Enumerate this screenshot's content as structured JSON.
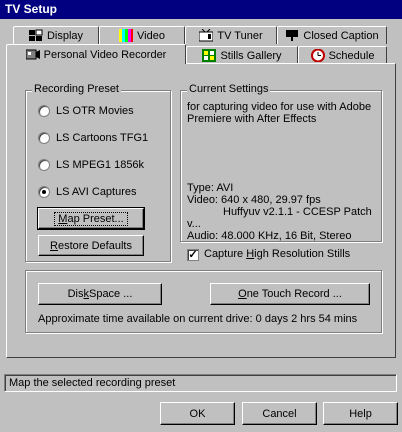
{
  "window": {
    "title": "TV Setup"
  },
  "tabs_row1": [
    {
      "label": "Display"
    },
    {
      "label": "Video"
    },
    {
      "label": "TV Tuner"
    },
    {
      "label": "Closed Caption"
    }
  ],
  "tabs_row2": [
    {
      "label": "Personal Video Recorder",
      "active": true
    },
    {
      "label": "Stills Gallery"
    },
    {
      "label": "Schedule"
    }
  ],
  "recording_preset": {
    "group_label": "Recording Preset",
    "options": [
      {
        "label": "LS OTR Movies",
        "checked": false
      },
      {
        "label": "LS Cartoons TFG1",
        "checked": false
      },
      {
        "label": "LS MPEG1 1856k",
        "checked": false
      },
      {
        "label": "LS AVI Captures",
        "checked": true
      }
    ],
    "map_button_prefix": "M",
    "map_button_rest": "ap Preset...",
    "restore_button_prefix": "R",
    "restore_button_rest": "estore Defaults"
  },
  "current_settings": {
    "group_label": "Current Settings",
    "description_1": "for capturing video for use with Adobe",
    "description_2": "Premiere with After Effects",
    "type": "Type:  AVI",
    "video": "Video:  640 x 480, 29.97 fps",
    "codec": "Huffyuv v2.1.1 - CCESP Patch",
    "codec_cont": "v...",
    "audio": "Audio:  48.000 KHz, 16 Bit, Stereo"
  },
  "capture_high_res": {
    "label_pre": "Capture ",
    "label_u": "H",
    "label_post": "igh Resolution Stills",
    "checked": true
  },
  "disk": {
    "disk_space_pre": "Dis",
    "disk_space_u": "k",
    "disk_space_post": " Space ...",
    "one_touch_u": "O",
    "one_touch_post": "ne Touch Record ...",
    "approx_time": "Approximate time available on current drive: 0 days 2 hrs 54 mins"
  },
  "status": {
    "text": "Map the selected recording preset"
  },
  "footer": {
    "ok": "OK",
    "cancel": "Cancel",
    "help": "Help"
  }
}
